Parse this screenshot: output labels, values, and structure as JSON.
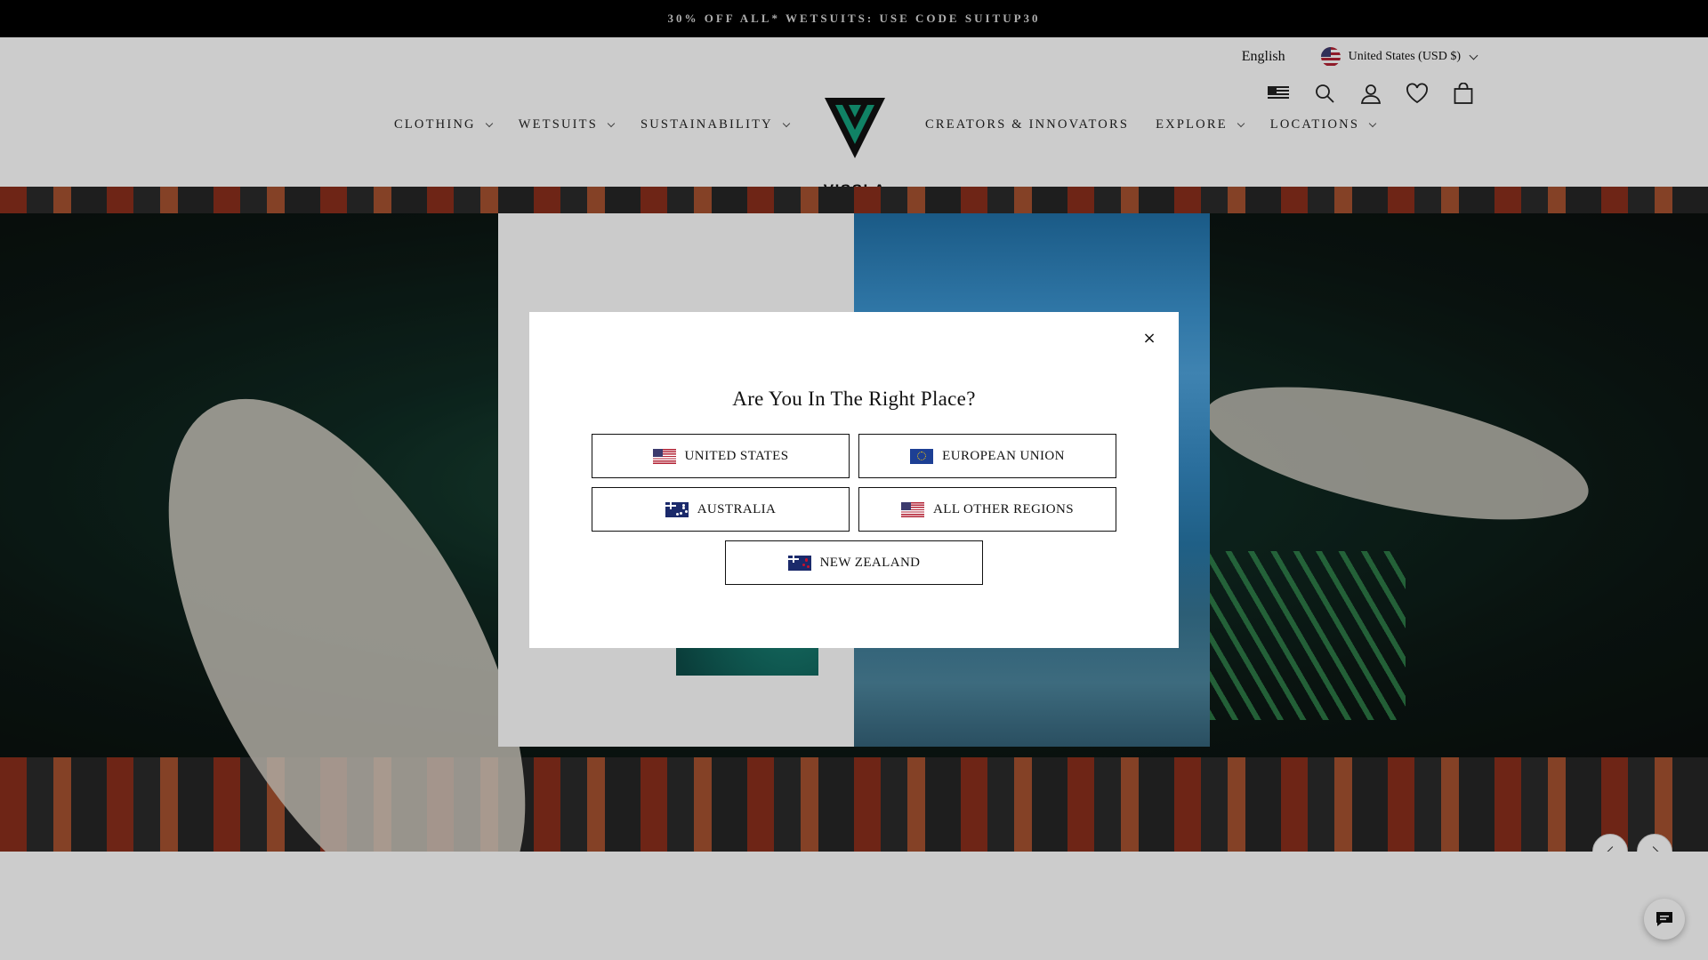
{
  "announcement": "30% OFF ALL* WETSUITS: USE CODE SUITUP30",
  "header": {
    "language": "English",
    "currency": "United States (USD $)",
    "logo_text": "VISSLA",
    "nav_left": [
      "CLOTHING",
      "WETSUITS",
      "SUSTAINABILITY"
    ],
    "nav_right": [
      "CREATORS & INNOVATORS",
      "EXPLORE",
      "LOCATIONS"
    ],
    "icons": [
      "us-flag-icon",
      "search-icon",
      "account-icon",
      "wishlist-heart-icon",
      "cart-bag-icon"
    ]
  },
  "modal": {
    "title": "Are You In The Right Place?",
    "close_symbol": "×",
    "regions": [
      {
        "label": "UNITED STATES",
        "flag": "us"
      },
      {
        "label": "EUROPEAN UNION",
        "flag": "eu"
      },
      {
        "label": "AUSTRALIA",
        "flag": "au"
      },
      {
        "label": "ALL OTHER REGIONS",
        "flag": "us"
      },
      {
        "label": "NEW ZEALAND",
        "flag": "nz"
      }
    ]
  },
  "colors": {
    "announcement_bg": "#000000",
    "modal_left_panel": "#cbcbcb",
    "logo_green": "#14a37f"
  }
}
